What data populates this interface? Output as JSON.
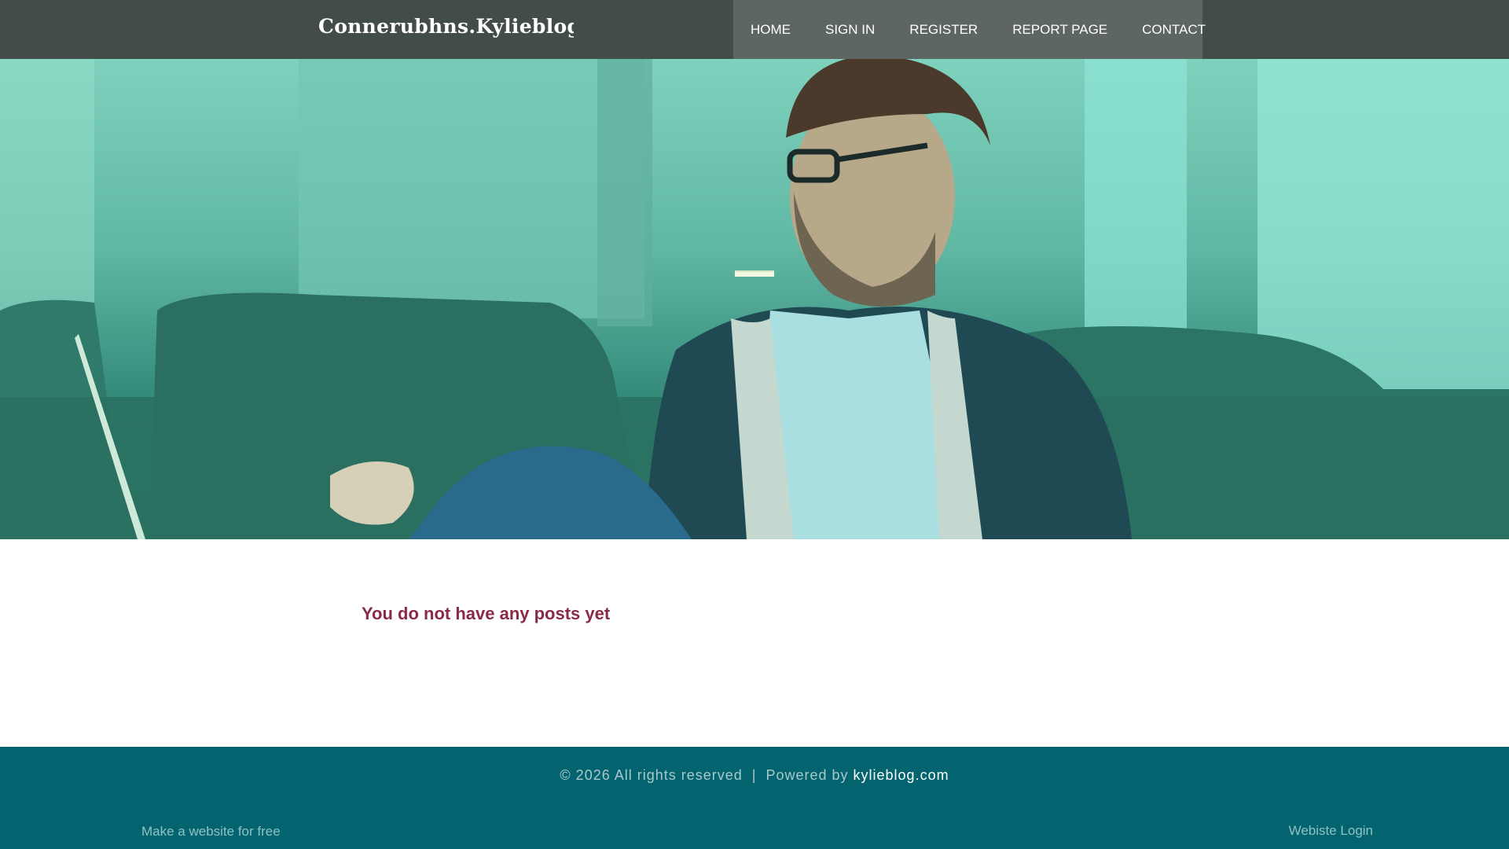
{
  "header": {
    "brand": "Connerubhns.Kylieblog.Com",
    "nav": [
      "HOME",
      "SIGN IN",
      "REGISTER",
      "REPORT PAGE",
      "CONTACT"
    ]
  },
  "main": {
    "empty_message": "You do not have any posts yet"
  },
  "footer": {
    "copyright_prefix": "© 2026 All rights reserved  |  Powered by ",
    "powered_link": "kylieblog.com",
    "make_website": "Make a website for free",
    "website_login": "Webiste Login"
  },
  "colors": {
    "header_bg": "#424c48",
    "nav_bg": "#5d6663",
    "hero_tint": "#5fb7a3",
    "accent_text": "#8a2a46",
    "footer_bg": "#03646f"
  }
}
